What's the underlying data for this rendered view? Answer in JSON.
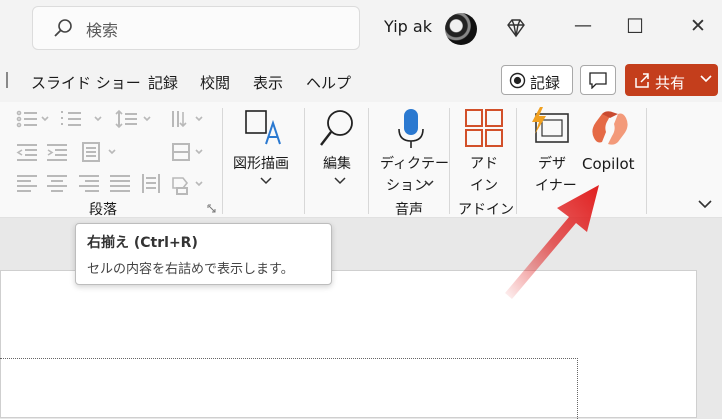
{
  "search": {
    "placeholder": "検索"
  },
  "account": {
    "user_name": "Yip ak"
  },
  "window_controls": {
    "minimize": "—",
    "maximize": "☐",
    "close": "✕"
  },
  "menu": {
    "items": [
      {
        "label": "スライド ショー"
      },
      {
        "label": "記録"
      },
      {
        "label": "校閲"
      },
      {
        "label": "表示"
      },
      {
        "label": "ヘルプ"
      }
    ],
    "record_button": "記録",
    "share_button": "共有"
  },
  "ribbon": {
    "paragraph_group": "段落",
    "shapes_line1": "図形描画",
    "editing": "編集",
    "dictation_line1": "ディクテー",
    "dictation_line2": "ション",
    "voice_group": "音声",
    "addin_line1": "アド",
    "addin_line2": "イン",
    "addin_group": "アドイン",
    "designer_line1": "デザ",
    "designer_line2": "イナー",
    "copilot": "Copilot"
  },
  "tooltip": {
    "title": "右揃え (Ctrl+R)",
    "description": "セルの内容を右詰めで表示します。"
  },
  "colors": {
    "share_button": "#c43e1c",
    "accent_blue": "#2b79d0",
    "addin_orange": "#d2502a",
    "arrow_red": "#e02020"
  }
}
